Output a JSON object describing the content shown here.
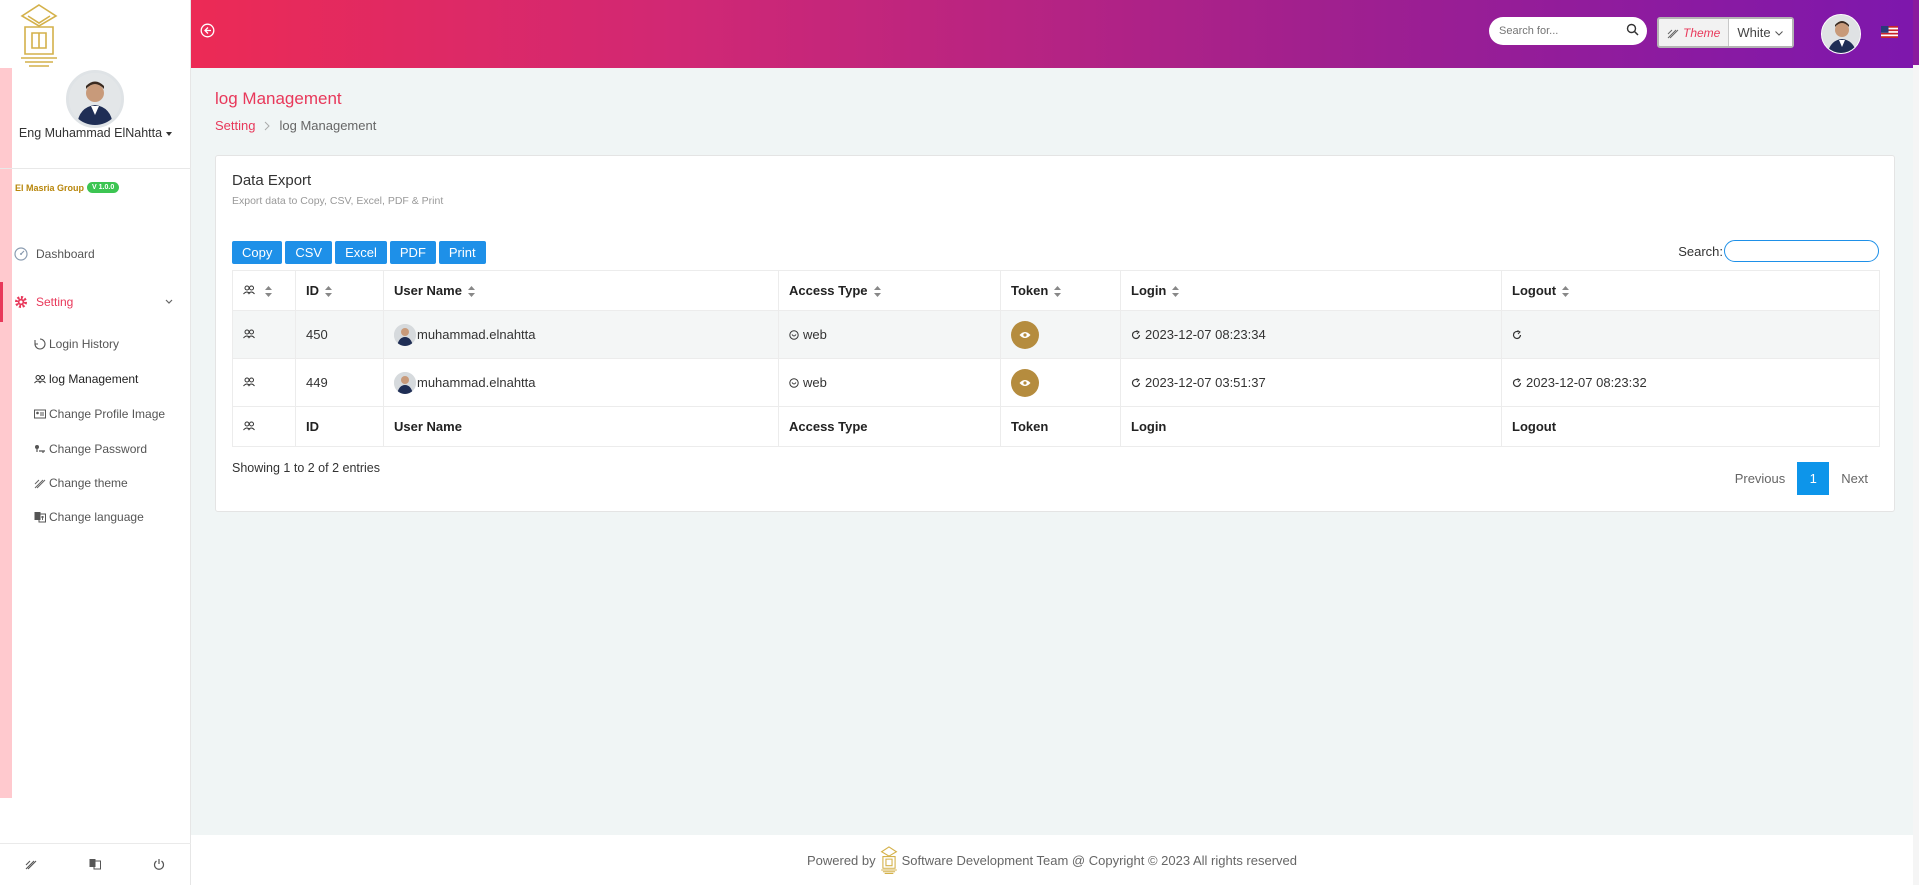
{
  "sidebar": {
    "user_name": "Eng Muhammad ElNahtta",
    "org_name": "El Masria Group",
    "version": "V 1.0.0",
    "dashboard_label": "Dashboard",
    "setting_label": "Setting",
    "sub_items": [
      {
        "label": "Login History",
        "icon": "login-history-icon"
      },
      {
        "label": "log Management",
        "icon": "users-icon"
      },
      {
        "label": "Change Profile Image",
        "icon": "id-card-icon"
      },
      {
        "label": "Change Password",
        "icon": "key-icon"
      },
      {
        "label": "Change theme",
        "icon": "palette-icon"
      },
      {
        "label": "Change language",
        "icon": "language-icon"
      }
    ]
  },
  "header": {
    "search_placeholder": "Search for...",
    "theme_label": "Theme",
    "theme_value": "White"
  },
  "page": {
    "title": "log Management",
    "breadcrumb": [
      "Setting",
      "log Management"
    ]
  },
  "card": {
    "title": "Data Export",
    "subtitle": "Export data to Copy, CSV, Excel, PDF & Print",
    "buttons": [
      "Copy",
      "CSV",
      "Excel",
      "PDF",
      "Print"
    ],
    "search_label": "Search:"
  },
  "table": {
    "columns": [
      "ID",
      "User Name",
      "Access Type",
      "Token",
      "Login",
      "Logout"
    ],
    "rows": [
      {
        "id": "450",
        "user": "muhammad.elnahtta",
        "access": "web",
        "login": "2023-12-07 08:23:34",
        "logout": ""
      },
      {
        "id": "449",
        "user": "muhammad.elnahtta",
        "access": "web",
        "login": "2023-12-07 03:51:37",
        "logout": "2023-12-07 08:23:32"
      }
    ]
  },
  "info": {
    "entries": "Showing 1 to 2 of 2 entries",
    "previous": "Previous",
    "current_page": "1",
    "next": "Next"
  },
  "footer": {
    "powered": "Powered by",
    "text": "Software Development Team @ Copyright © 2023 All rights reserved"
  },
  "colors": {
    "accent": "#e8385a",
    "button": "#1e90e8",
    "token": "#b58c3e"
  }
}
